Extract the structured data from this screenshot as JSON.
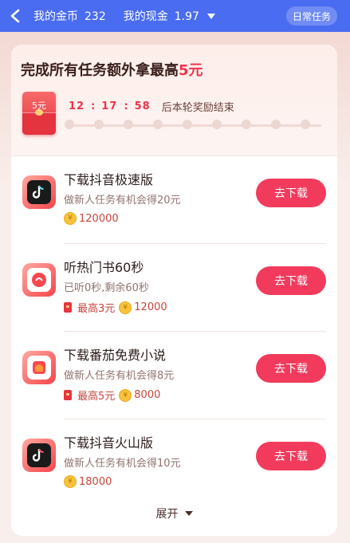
{
  "header": {
    "coins_label": "我的金币",
    "coins_value": "232",
    "cash_label": "我的现金",
    "cash_value": "1.97",
    "daily_tasks": "日常任务"
  },
  "banner": {
    "title_prefix": "完成所有任务额外拿最高",
    "title_amount": "5元",
    "redpacket_amount": "5元",
    "timer": {
      "h": "12",
      "m": "17",
      "s": "58"
    },
    "timer_tail": "后本轮奖励结束"
  },
  "tasks": [
    {
      "title": "下载抖音极速版",
      "desc": "做新人任务有机会得20元",
      "max_label": "",
      "coins": "120000",
      "button": "去下载",
      "icon": "douyin-lite-icon"
    },
    {
      "title": "听热门书60秒",
      "desc": "已听0秒,剩余60秒",
      "max_label": "最高3元",
      "coins": "12000",
      "button": "去下载",
      "icon": "tomato-listen-icon"
    },
    {
      "title": "下载番茄免费小说",
      "desc": "做新人任务有机会得8元",
      "max_label": "最高5元",
      "coins": "8000",
      "button": "去下载",
      "icon": "tomato-novel-icon"
    },
    {
      "title": "下载抖音火山版",
      "desc": "做新人任务有机会得10元",
      "max_label": "",
      "coins": "18000",
      "button": "去下载",
      "icon": "douyin-volcano-icon"
    }
  ],
  "footer": {
    "expand": "展开"
  },
  "colors": {
    "primary": "#4a6cf1",
    "accent": "#f23b5c",
    "coin": "#f8c33a"
  }
}
